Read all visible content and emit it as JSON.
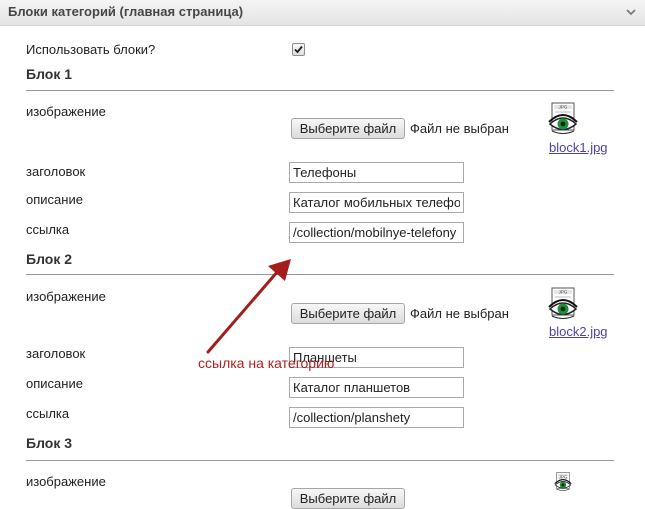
{
  "panel": {
    "title": "Блоки категорий (главная страница)"
  },
  "use_blocks": {
    "label": "Использовать блоки?",
    "checked": true
  },
  "labels": {
    "image": "изображение",
    "title": "заголовок",
    "description": "описание",
    "link": "ссылка"
  },
  "file_input": {
    "button_label": "Выберите файл",
    "status": "Файл не выбран"
  },
  "thumbnail": {
    "badge": "JPG"
  },
  "blocks": [
    {
      "heading": "Блок 1",
      "image_file": "block1.jpg",
      "title_value": "Телефоны",
      "description_value": "Каталог мобильных телефонов",
      "link_value": "/collection/mobilnye-telefony"
    },
    {
      "heading": "Блок 2",
      "image_file": "block2.jpg",
      "title_value": "Планшеты",
      "description_value": "Каталог планшетов",
      "link_value": "/collection/planshety"
    },
    {
      "heading": "Блок 3"
    }
  ],
  "annotation": {
    "text": "ссылка на категорию",
    "color": "#b21e1e"
  },
  "colors": {
    "link": "#4b3fb5",
    "header_bg": "#e8e8e8",
    "divider": "#9a9a9a"
  }
}
